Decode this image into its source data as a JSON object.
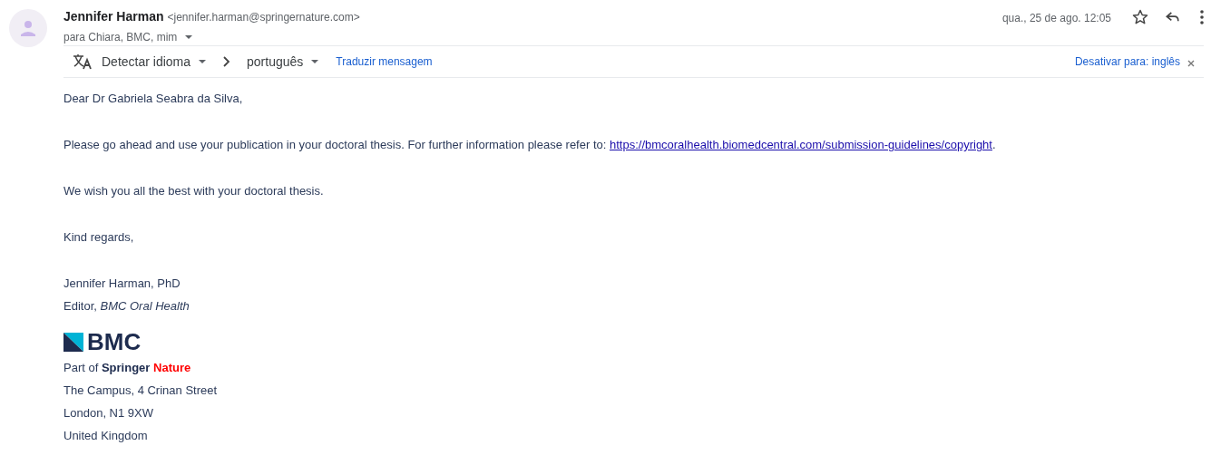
{
  "header": {
    "sender_name": "Jennifer Harman",
    "sender_email": "<jennifer.harman@springernature.com>",
    "recipients": "para Chiara, BMC, mim",
    "date": "qua., 25 de ago. 12:05",
    "starred": false
  },
  "translate_bar": {
    "source_language": "Detectar idioma",
    "target_language": "português",
    "translate_link": "Traduzir mensagem",
    "disable_link": "Desativar para: inglês"
  },
  "body": {
    "greeting": "Dear Dr Gabriela Seabra da Silva,",
    "paragraph": {
      "text": "Please go ahead and use your publication in your doctoral thesis. For further information please refer to: ",
      "link": "https://bmcoralhealth.biomedcentral.com/submission-guidelines/copyright",
      "after": "."
    },
    "wish": "We wish you all the best with your doctoral thesis.",
    "closing": "Kind regards,",
    "signature_name": "Jennifer Harman, PhD",
    "signature_role": "Editor, *BMC Oral Health*",
    "logo_text": "BMC",
    "part_of": [
      {
        "text": "Part of",
        "bold": false,
        "color": "#2c3b5a"
      },
      {
        "text": "Springer",
        "bold": true,
        "color": "#1d2b4e"
      },
      {
        "text": "Nature",
        "bold": true,
        "color": "#ff0000"
      }
    ],
    "address": [
      "The Campus, 4 Crinan Street",
      "London, N1 9XW",
      "United Kingdom"
    ]
  }
}
